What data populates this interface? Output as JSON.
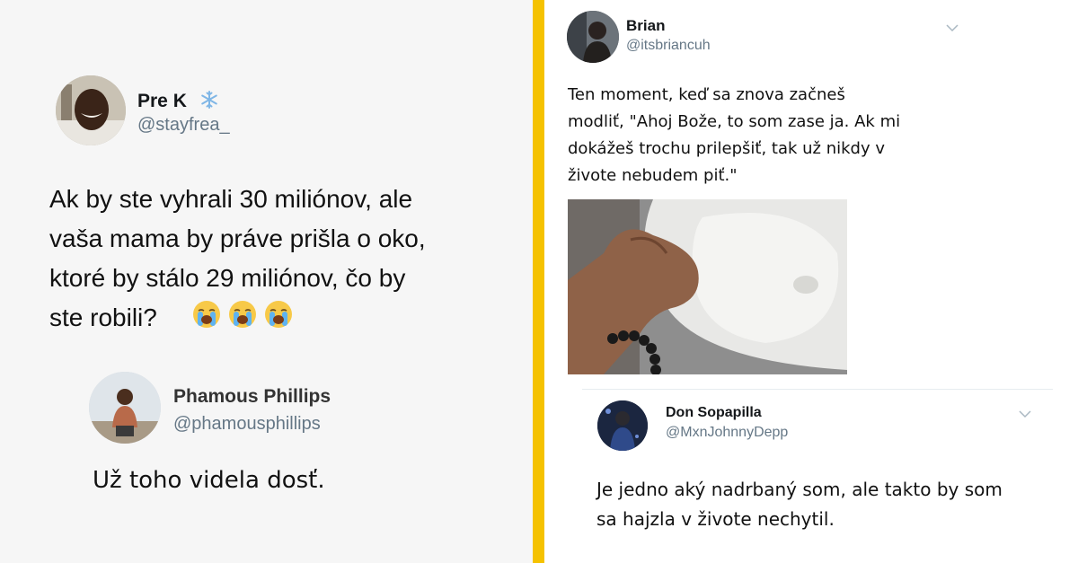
{
  "left_tweet": {
    "author_name": "Pre K",
    "author_handle": "@stayfrea_",
    "badge_icon": "snowflake-icon",
    "text": "Ak by ste vyhrali 30 miliónov, ale\nvaša mama by práve prišla o oko,\nktoré by stálo 29 miliónov, čo by\nste robili?",
    "emojis": [
      "loudly-crying-face-icon",
      "loudly-crying-face-icon",
      "loudly-crying-face-icon"
    ]
  },
  "left_reply": {
    "author_name": "Phamous Phillips",
    "author_handle": "@phamousphillips",
    "text": "Už toho videla dosť."
  },
  "right_tweet": {
    "author_name": "Brian",
    "author_handle": "@itsbriancuh",
    "text": "Ten moment, keď sa znova začneš\nmodliť, \"Ahoj Bože, to som zase ja. Ak mi\ndokážeš trochu prilepšiť, tak už nikdy v\nživote nebudem piť.\""
  },
  "right_reply": {
    "author_name": "Don Sopapilla",
    "author_handle": "@MxnJohnnyDepp",
    "text": "Je jedno aký nadrbaný som, ale takto by som\nsa hajzla v živote nechytil."
  },
  "colors": {
    "divider": "#f5c200",
    "handle_gray": "#657786",
    "left_background": "#f6f6f6"
  }
}
